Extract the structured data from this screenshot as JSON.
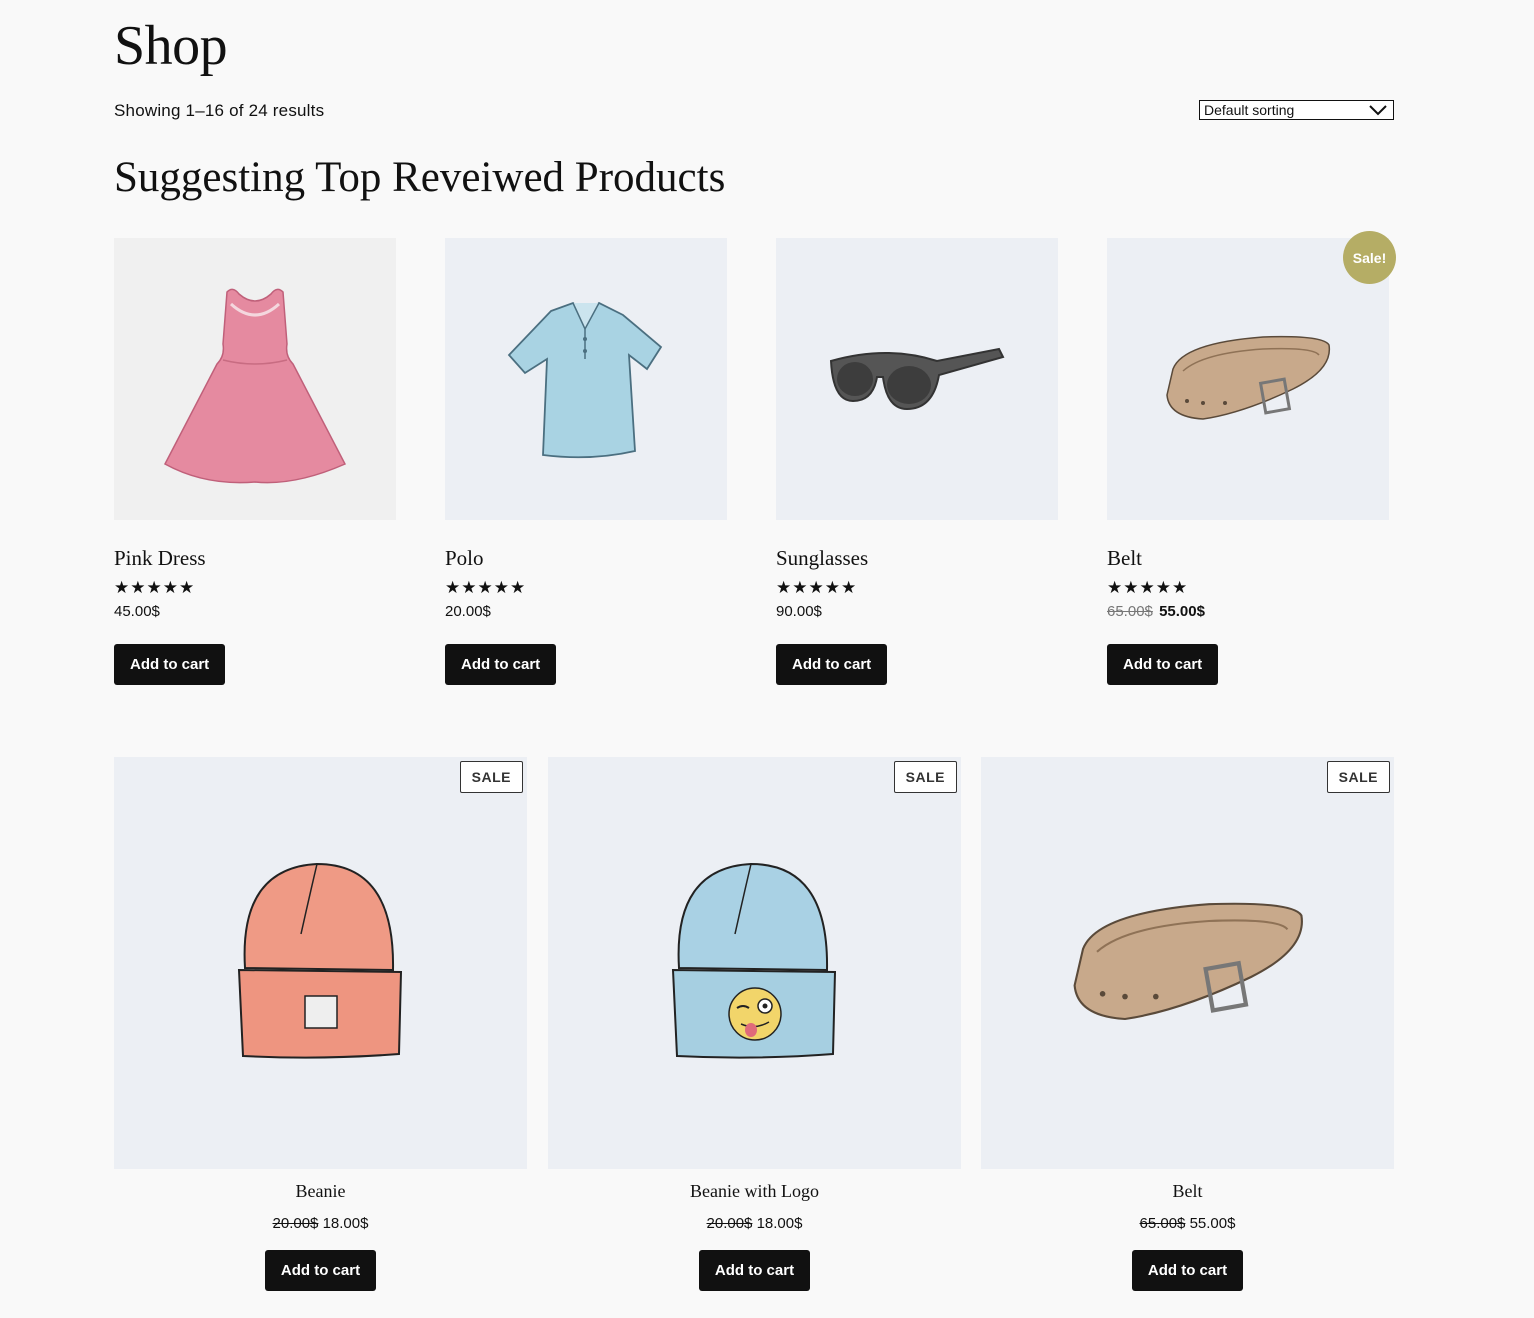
{
  "page": {
    "title": "Shop",
    "result_count": "Showing 1–16 of 24 results",
    "sort": {
      "selected": "Default sorting"
    },
    "section_title": "Suggesting Top Reveiwed Products"
  },
  "top_products": [
    {
      "name": "Pink Dress",
      "price": "45.00$",
      "rating": 5,
      "button": "Add to cart",
      "icon": "dress-icon"
    },
    {
      "name": "Polo",
      "price": "20.00$",
      "rating": 5,
      "button": "Add to cart",
      "icon": "polo-shirt-icon"
    },
    {
      "name": "Sunglasses",
      "price": "90.00$",
      "rating": 5,
      "button": "Add to cart",
      "icon": "sunglasses-icon"
    },
    {
      "name": "Belt",
      "old_price": "65.00$",
      "price": "55.00$",
      "rating": 5,
      "button": "Add to cart",
      "badge": "Sale!",
      "icon": "belt-icon"
    }
  ],
  "bottom_products": [
    {
      "name": "Beanie",
      "old_price": "20.00$",
      "price": "18.00$",
      "button": "Add to cart",
      "badge": "SALE",
      "icon": "beanie-icon"
    },
    {
      "name": "Beanie with Logo",
      "old_price": "20.00$",
      "price": "18.00$",
      "button": "Add to cart",
      "badge": "SALE",
      "icon": "beanie-logo-icon"
    },
    {
      "name": "Belt",
      "old_price": "65.00$",
      "price": "55.00$",
      "button": "Add to cart",
      "badge": "SALE",
      "icon": "belt-icon"
    }
  ],
  "colors": {
    "background": "#f9f9f9",
    "image_bg": "#eceff4",
    "button": "#111111",
    "sale_badge": "#b5ad65"
  }
}
